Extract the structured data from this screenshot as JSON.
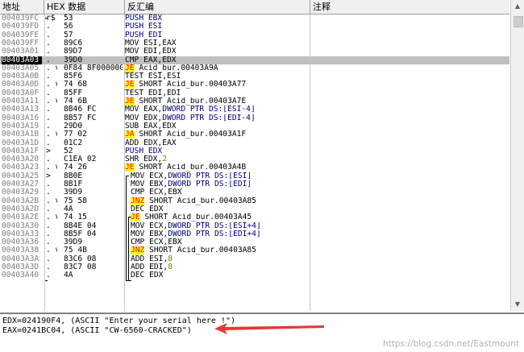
{
  "header": {
    "addr": "地址",
    "hex": "HEX",
    "data": "数据",
    "disasm": "反汇编",
    "comment": "注释"
  },
  "rows": [
    {
      "addr": "004039FC",
      "mark": "r$",
      "hex": "53",
      "parts": [
        [
          "kw",
          "PUSH EBX"
        ]
      ]
    },
    {
      "addr": "004039FD",
      "mark": ".",
      "hex": "56",
      "parts": [
        [
          "kw",
          "PUSH ESI"
        ]
      ]
    },
    {
      "addr": "004039FE",
      "mark": ".",
      "hex": "57",
      "parts": [
        [
          "kw",
          "PUSH EDI"
        ]
      ]
    },
    {
      "addr": "004039FF",
      "mark": ".",
      "hex": "89C6",
      "parts": [
        [
          "reg",
          "MOV ESI,EAX"
        ]
      ]
    },
    {
      "addr": "00403A01",
      "mark": ".",
      "hex": "89D7",
      "parts": [
        [
          "reg",
          "MOV EDI,EDX"
        ]
      ]
    },
    {
      "addr": "00403A03",
      "mark": ".",
      "hex": "39D0",
      "parts": [
        [
          "reg",
          "CMP EAX,EDX"
        ]
      ],
      "selected": true
    },
    {
      "addr": "00403A05",
      "mark": ". v",
      "hex": "0F84 8F000000",
      "parts": [
        [
          "jmp",
          "JE"
        ],
        [
          "reg",
          " Acid_bur.00403A9A"
        ]
      ],
      "hl": true
    },
    {
      "addr": "00403A0B",
      "mark": ".",
      "hex": "85F6",
      "parts": [
        [
          "reg",
          "TEST ESI,ESI"
        ]
      ]
    },
    {
      "addr": "00403A0D",
      "mark": ". v",
      "hex": "74 68",
      "parts": [
        [
          "jmp",
          "JE"
        ],
        [
          "reg",
          " SHORT Acid_bur.00403A77"
        ]
      ],
      "hl": true
    },
    {
      "addr": "00403A0F",
      "mark": ".",
      "hex": "85FF",
      "parts": [
        [
          "reg",
          "TEST EDI,EDI"
        ]
      ]
    },
    {
      "addr": "00403A11",
      "mark": ". v",
      "hex": "74 6B",
      "parts": [
        [
          "jmp",
          "JE"
        ],
        [
          "reg",
          " SHORT Acid_bur.00403A7E"
        ]
      ],
      "hl": true
    },
    {
      "addr": "00403A13",
      "mark": ".",
      "hex": "8B46 FC",
      "parts": [
        [
          "reg",
          "MOV EAX,"
        ],
        [
          "kw",
          "DWORD PTR DS:[ESI-4]"
        ]
      ]
    },
    {
      "addr": "00403A16",
      "mark": ".",
      "hex": "8B57 FC",
      "parts": [
        [
          "reg",
          "MOV EDX,"
        ],
        [
          "kw",
          "DWORD PTR DS:[EDI-4]"
        ]
      ]
    },
    {
      "addr": "00403A19",
      "mark": ".",
      "hex": "29D0",
      "parts": [
        [
          "reg",
          "SUB EAX,EDX"
        ]
      ]
    },
    {
      "addr": "00403A1B",
      "mark": ". v",
      "hex": "77 02",
      "parts": [
        [
          "jmp",
          "JA"
        ],
        [
          "reg",
          " SHORT Acid_bur.00403A1F"
        ]
      ],
      "hl": true
    },
    {
      "addr": "00403A1D",
      "mark": ".",
      "hex": "01C2",
      "parts": [
        [
          "reg",
          "ADD EDX,EAX"
        ]
      ]
    },
    {
      "addr": "00403A1F",
      "mark": ">",
      "hex": "52",
      "parts": [
        [
          "kw",
          "PUSH EDX"
        ]
      ]
    },
    {
      "addr": "00403A20",
      "mark": ".",
      "hex": "C1EA 02",
      "parts": [
        [
          "reg",
          "SHR EDX,"
        ],
        [
          "num",
          "2"
        ]
      ]
    },
    {
      "addr": "00403A23",
      "mark": ". v",
      "hex": "74 26",
      "parts": [
        [
          "jmp",
          "JE"
        ],
        [
          "reg",
          " SHORT Acid_bur.00403A4B"
        ]
      ],
      "hl": true
    },
    {
      "addr": "00403A25",
      "mark": ">",
      "hex": "8B0E",
      "parts": [
        [
          "reg",
          "MOV ECX,"
        ],
        [
          "kw",
          "DWORD PTR DS:[ESI]"
        ]
      ]
    },
    {
      "addr": "00403A27",
      "mark": ".",
      "hex": "8B1F",
      "parts": [
        [
          "reg",
          "MOV EBX,"
        ],
        [
          "kw",
          "DWORD PTR DS:[EDI]"
        ]
      ]
    },
    {
      "addr": "00403A29",
      "mark": ".",
      "hex": "39D9",
      "parts": [
        [
          "reg",
          "CMP ECX,EBX"
        ]
      ]
    },
    {
      "addr": "00403A2B",
      "mark": ". v",
      "hex": "75 58",
      "parts": [
        [
          "jmp",
          "JNZ"
        ],
        [
          "reg",
          " SHORT Acid_bur.00403A85"
        ]
      ],
      "hl": true
    },
    {
      "addr": "00403A2D",
      "mark": ".",
      "hex": "4A",
      "parts": [
        [
          "reg",
          "DEC EDX"
        ]
      ]
    },
    {
      "addr": "00403A2E",
      "mark": ". v",
      "hex": "74 15",
      "parts": [
        [
          "jmp",
          "JE"
        ],
        [
          "reg",
          " SHORT Acid_bur.00403A45"
        ]
      ],
      "hl": true
    },
    {
      "addr": "00403A30",
      "mark": ".",
      "hex": "8B4E 04",
      "parts": [
        [
          "reg",
          "MOV ECX,"
        ],
        [
          "kw",
          "DWORD PTR DS:[ESI+4]"
        ]
      ]
    },
    {
      "addr": "00403A33",
      "mark": ".",
      "hex": "8B5F 04",
      "parts": [
        [
          "reg",
          "MOV EBX,"
        ],
        [
          "kw",
          "DWORD PTR DS:[EDI+4]"
        ]
      ]
    },
    {
      "addr": "00403A36",
      "mark": ".",
      "hex": "39D9",
      "parts": [
        [
          "reg",
          "CMP ECX,EBX"
        ]
      ]
    },
    {
      "addr": "00403A38",
      "mark": ". v",
      "hex": "75 4B",
      "parts": [
        [
          "jmp",
          "JNZ"
        ],
        [
          "reg",
          " SHORT Acid_bur.00403A85"
        ]
      ],
      "hl": true
    },
    {
      "addr": "00403A3A",
      "mark": ".",
      "hex": "83C6 08",
      "parts": [
        [
          "reg",
          "ADD ESI,"
        ],
        [
          "num",
          "8"
        ]
      ]
    },
    {
      "addr": "00403A3D",
      "mark": ".",
      "hex": "83C7 08",
      "parts": [
        [
          "reg",
          "ADD EDI,"
        ],
        [
          "num",
          "8"
        ]
      ]
    },
    {
      "addr": "00403A40",
      "mark": ".",
      "hex": "4A",
      "parts": [
        [
          "reg",
          "DEC EDX"
        ]
      ]
    }
  ],
  "info": {
    "line1": "EDX=024190F4, (ASCII \"Enter your serial here !\")",
    "line2": "EAX=0241BC04, (ASCII \"CW-6560-CRACKED\")"
  },
  "watermark": "https://blog.csdn.net/Eastmount"
}
